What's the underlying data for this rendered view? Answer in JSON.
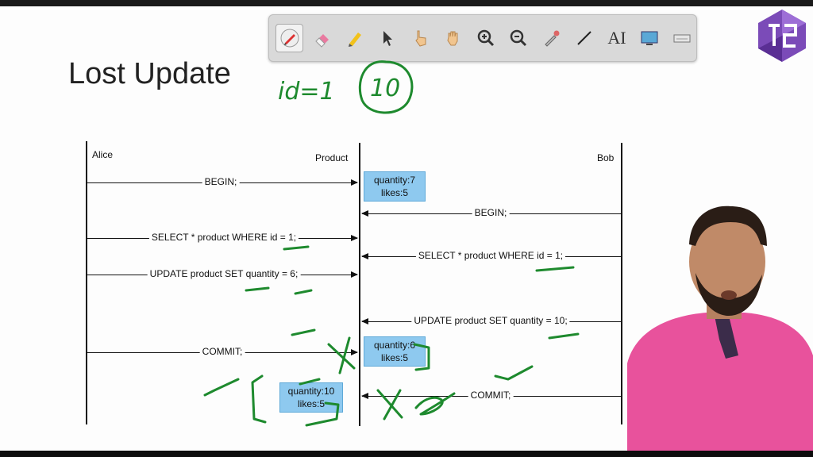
{
  "slide": {
    "title": "Lost Update",
    "handwritten_note": "id=1",
    "handwritten_value": "10"
  },
  "toolbar": {
    "tools": [
      "pen",
      "eraser",
      "highlighter",
      "pointer",
      "hand-pointer",
      "hand-pan",
      "zoom-in",
      "zoom-out",
      "color-picker",
      "line",
      "AI",
      "screen",
      "keyboard"
    ],
    "text_tool_label": "AI"
  },
  "diagram": {
    "participants": {
      "alice": "Alice",
      "product": "Product",
      "bob": "Bob"
    },
    "messages": [
      {
        "label": "BEGIN;"
      },
      {
        "label": "BEGIN;"
      },
      {
        "label": "SELECT * product WHERE id = 1;"
      },
      {
        "label": "SELECT * product WHERE id = 1;"
      },
      {
        "label": "UPDATE product SET quantity = 6;"
      },
      {
        "label": "UPDATE product SET quantity = 10;"
      },
      {
        "label": "COMMIT;"
      },
      {
        "label": "COMMIT;"
      }
    ],
    "states": [
      {
        "line1": "quantity:7",
        "line2": "likes:5"
      },
      {
        "line1": "quantity:6",
        "line2": "likes:5"
      },
      {
        "line1": "quantity:10",
        "line2": "likes:5"
      }
    ]
  },
  "colors": {
    "ink": "#1e8a2e",
    "state_fill": "#8ec9ef",
    "presenter_shirt": "#e8529c"
  }
}
